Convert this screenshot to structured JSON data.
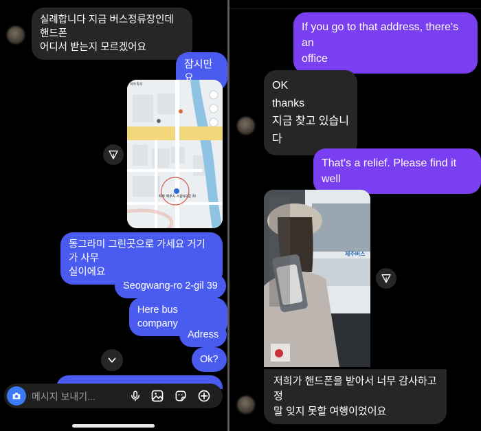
{
  "left": {
    "messages": {
      "m1": "실례합니다 지금 버스정류장인데 핸드폰\n어디서 받는지 모르겠어요",
      "m2": "잠시만요",
      "m3": "동그라미 그린곳으로 가세요 거기가 사무\n실이에요",
      "m4": "Seogwang-ro 2-gil 39",
      "m5": "Here bus company",
      "m6": "Adress",
      "m7": "Ok?"
    },
    "map_labels": {
      "top_left": "제주특례",
      "pin_label": "제주 제주시 서광로2길 39"
    },
    "composer": {
      "placeholder": "메시지 보내기..."
    }
  },
  "right": {
    "messages": {
      "m1": "If you go to that address, there's an\noffice",
      "m2": "OK\nthanks\n지금 찾고 있습니다",
      "m3": "That's a relief. Please find it well",
      "m4": "저희가 핸드폰을 받아서 너무 감사하고 정\n말 잊지 못할 여행이었어요"
    },
    "photo_labels": {
      "bus_text": "제주버스"
    }
  },
  "colors": {
    "outgoing_blue": "#4a5bf0",
    "outgoing_purple": "#7a3ff0",
    "incoming_gray": "#262626",
    "camera_blue": "#3a7bf5"
  },
  "icons": [
    "camera-icon",
    "microphone-icon",
    "gallery-icon",
    "sticker-icon",
    "plus-icon",
    "share-icon",
    "chevron-down-icon"
  ]
}
